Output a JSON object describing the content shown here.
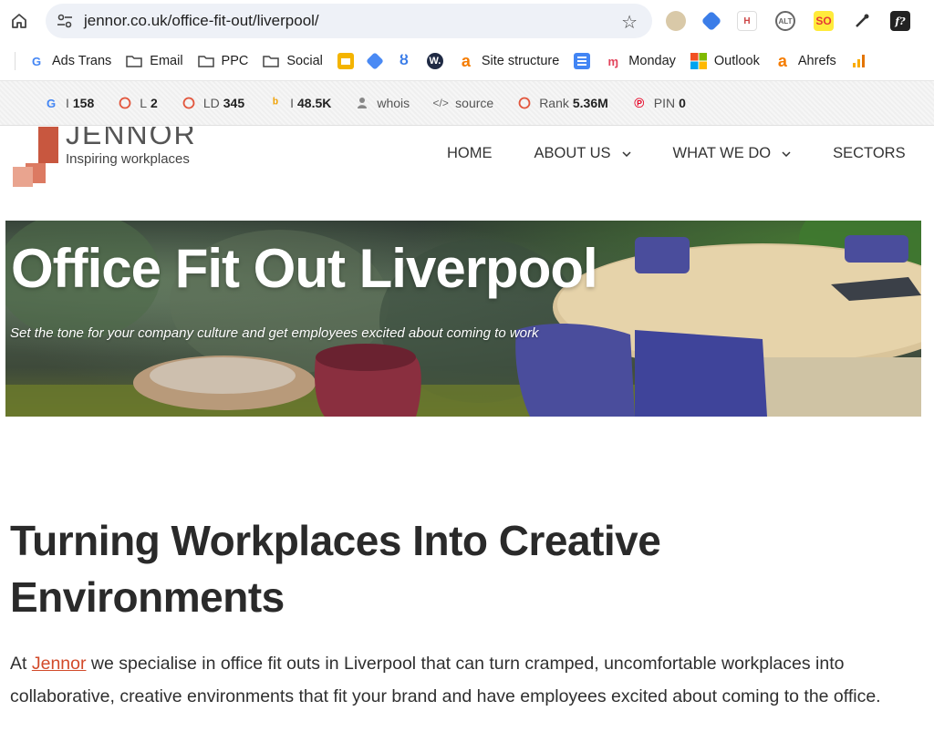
{
  "browser": {
    "url": "jennor.co.uk/office-fit-out/liverpool/",
    "bookmarks": [
      {
        "label": "Ads Trans",
        "icon": "google-icon"
      },
      {
        "label": "Email",
        "icon": "folder-icon"
      },
      {
        "label": "PPC",
        "icon": "folder-icon"
      },
      {
        "label": "Social",
        "icon": "folder-icon"
      },
      {
        "label": "",
        "icon": "slides-icon"
      },
      {
        "label": "",
        "icon": "tag-manager-icon"
      },
      {
        "label": "",
        "icon": "link-icon"
      },
      {
        "label": "",
        "icon": "w-icon"
      },
      {
        "label": "Site structure",
        "icon": "a-icon"
      },
      {
        "label": "",
        "icon": "docs-icon"
      },
      {
        "label": "Monday",
        "icon": "monday-icon"
      },
      {
        "label": "Outlook",
        "icon": "microsoft-icon"
      },
      {
        "label": "Ahrefs",
        "icon": "a-icon"
      },
      {
        "label": "",
        "icon": "analytics-icon"
      }
    ]
  },
  "seo_toolbar": {
    "google_index": {
      "prefix": "I",
      "value": "158"
    },
    "links": {
      "prefix": "L",
      "value": "2"
    },
    "link_domains": {
      "prefix": "LD",
      "value": "345"
    },
    "bing": {
      "prefix": "I",
      "value": "48.5K"
    },
    "whois": "whois",
    "source": "source",
    "rank": {
      "prefix": "Rank",
      "value": "5.36M"
    },
    "pin": {
      "prefix": "PIN",
      "value": "0"
    }
  },
  "site": {
    "logo_name": "JENNOR",
    "logo_tagline": "Inspiring workplaces",
    "nav": [
      "HOME",
      "ABOUT US",
      "WHAT WE DO",
      "SECTORS"
    ],
    "hero_title": "Office Fit Out Liverpool",
    "hero_subtitle": "Set the tone for your company culture and get employees excited about coming to work",
    "heading": "Turning Workplaces Into Creative Environments",
    "para_start": "At ",
    "para_link": "Jennor",
    "para_end": " we specialise in office fit outs in Liverpool that can turn cramped, uncomfortable workplaces into collaborative, creative environments that fit your brand and have employees excited about coming to the office."
  },
  "colors": {
    "omnibox_bg": "#eef1f7",
    "link": "#d24a2a",
    "logo_orange": "#c8573f",
    "logo_peach": "#e9a48f"
  }
}
